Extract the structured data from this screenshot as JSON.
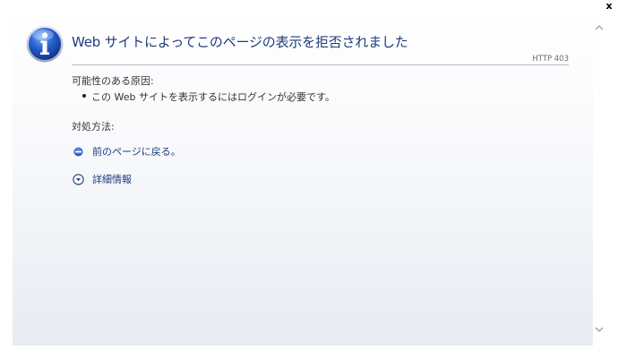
{
  "window": {
    "close_label": "x"
  },
  "error_page": {
    "title": "Web サイトによってこのページの表示を拒否されました",
    "http_status": "HTTP 403",
    "causes_heading": "可能性のある原因:",
    "causes": [
      "この Web サイトを表示するにはログインが必要です。"
    ],
    "solutions_heading": "対処方法:",
    "actions": {
      "back_label": "前のページに戻る。",
      "more_info_label": "詳細情報"
    }
  },
  "colors": {
    "title": "#1f3d7a",
    "link": "#1f3d7a",
    "body_text": "#333333",
    "rule": "#b9bec6",
    "icon_blue": "#1d4fb8"
  },
  "icons": {
    "status": "info-icon",
    "back": "back-bullet-icon",
    "more_info": "expand-chevron-icon",
    "scroll_up": "chevron-up-icon",
    "scroll_down": "chevron-down-icon"
  }
}
